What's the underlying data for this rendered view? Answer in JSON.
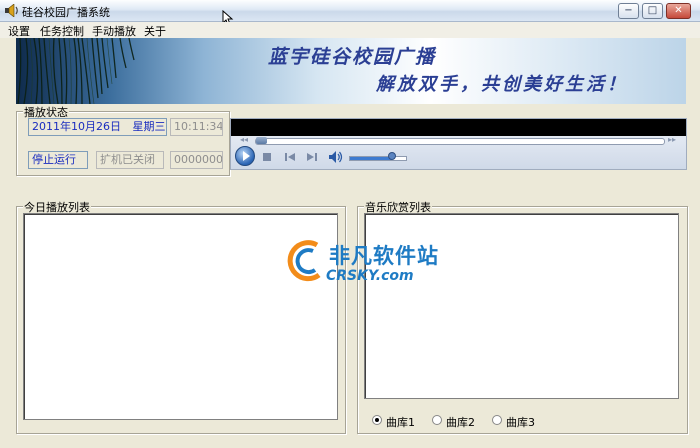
{
  "window": {
    "title": "硅谷校园广播系统",
    "buttons": {
      "minimize": "−",
      "maximize": "□",
      "close": "✕"
    }
  },
  "menu": [
    "设置",
    "任务控制",
    "手动播放",
    "关于"
  ],
  "banner": {
    "title": "蓝宇硅谷校园广播",
    "slogan": "解放双手，共创美好生活！"
  },
  "status_group": {
    "label": "播放状态",
    "date": "2011年10月26日",
    "weekday": "星期三",
    "time": "10:11:34",
    "run_state": "停止运行",
    "amp_state": "扩机已关闭",
    "counter": "00000000"
  },
  "player": {
    "seek_position": 0.0,
    "volume": 0.75,
    "rewind_glyph": "◂◂",
    "forward_glyph": "▸▸"
  },
  "today_list": {
    "label": "今日播放列表",
    "items": []
  },
  "music_list": {
    "label": "音乐欣赏列表",
    "items": [],
    "libraries": [
      {
        "label": "曲库1",
        "checked": true
      },
      {
        "label": "曲库2",
        "checked": false
      },
      {
        "label": "曲库3",
        "checked": false
      }
    ]
  },
  "watermark": {
    "cn": "非凡软件站",
    "en": "CRSKY.com"
  },
  "colors": {
    "accent_blue": "#1a2dbf",
    "banner_text": "#2b3f94",
    "watermark": "#1e7bc4"
  }
}
